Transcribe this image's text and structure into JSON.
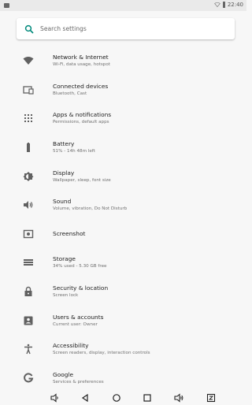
{
  "status_bar": {
    "time": "22:40"
  },
  "search": {
    "placeholder": "Search settings"
  },
  "settings": [
    {
      "title": "Network & Internet",
      "subtitle": "Wi-Fi, data usage, hotspot",
      "icon": "wifi-icon"
    },
    {
      "title": "Connected devices",
      "subtitle": "Bluetooth, Cast",
      "icon": "devices-icon"
    },
    {
      "title": "Apps & notifications",
      "subtitle": "Permissions, default apps",
      "icon": "apps-icon"
    },
    {
      "title": "Battery",
      "subtitle": "51% - 14h 48m left",
      "icon": "battery-icon"
    },
    {
      "title": "Display",
      "subtitle": "Wallpaper, sleep, font size",
      "icon": "brightness-icon"
    },
    {
      "title": "Sound",
      "subtitle": "Volume, vibration, Do Not Disturb",
      "icon": "volume-icon"
    },
    {
      "title": "Screenshot",
      "subtitle": "",
      "icon": "screenshot-icon"
    },
    {
      "title": "Storage",
      "subtitle": "34% used - 5.30 GB free",
      "icon": "storage-icon"
    },
    {
      "title": "Security & location",
      "subtitle": "Screen lock",
      "icon": "lock-icon"
    },
    {
      "title": "Users & accounts",
      "subtitle": "Current user: Owner",
      "icon": "account-icon"
    },
    {
      "title": "Accessibility",
      "subtitle": "Screen readers, display, interaction controls",
      "icon": "accessibility-icon"
    },
    {
      "title": "Google",
      "subtitle": "Services & preferences",
      "icon": "google-icon"
    }
  ],
  "navigation": [
    "volume-down-icon",
    "back-icon",
    "home-icon",
    "recents-icon",
    "volume-up-icon",
    "screenshot-nav-icon"
  ],
  "colors": {
    "accent": "#00897b",
    "icon": "#616161",
    "background": "#f7f7f7"
  }
}
